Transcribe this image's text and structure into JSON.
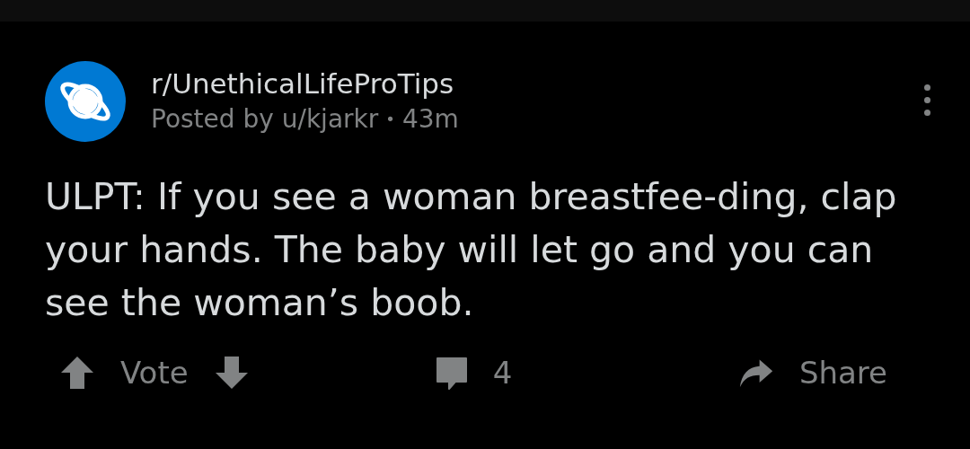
{
  "post": {
    "subreddit": "r/UnethicalLifeProTips",
    "posted_by": "Posted by u/kjarkr",
    "separator": "•",
    "age": "43m",
    "title": "ULPT: If you see a woman breastfee-ding, clap your hands. The baby will let go and you can see the woman’s boob."
  },
  "actions": {
    "vote_label": "Vote",
    "comment_count": "4",
    "share_label": "Share"
  }
}
